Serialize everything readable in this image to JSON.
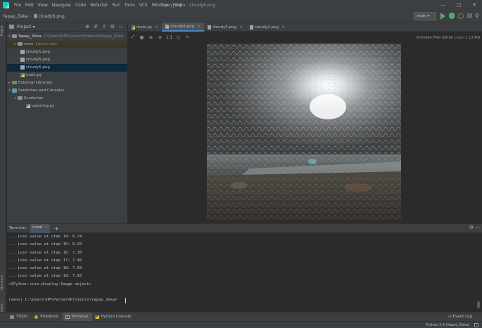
{
  "menubar": {
    "items": [
      "File",
      "Edit",
      "View",
      "Navigate",
      "Code",
      "Refactor",
      "Run",
      "Tools",
      "VCS",
      "Window",
      "Help"
    ],
    "window_title": "Yapay_Zeka - cloudy6.png"
  },
  "navbar": {
    "project": "Yapay_Zeka",
    "file": "cloudy6.png",
    "run_config": "main"
  },
  "left_stripe": {
    "top_tab": "Project",
    "bottom_tabs": [
      "Structure",
      "Favorites"
    ]
  },
  "project_panel": {
    "title": "Project",
    "root": {
      "name": "Yapay_Zeka",
      "path": "C:\\Users\\HP\\PycharmProjects\\Yapay_Zeka"
    },
    "venv": {
      "name": "venv",
      "hint": "library root"
    },
    "files": [
      "cloudy1.png",
      "cloudy5.png",
      "cloudy6.png",
      "main.py"
    ],
    "external_libraries": "External Libraries",
    "scratches_root": "Scratches and Consoles",
    "scratches_folder": "Scratches",
    "scratch_file": "Learning.py"
  },
  "editor": {
    "tabs": [
      "main.py",
      "cloudy6.png",
      "cloudy5.png",
      "cloudy1.png"
    ],
    "active_tab": "cloudy6.png",
    "image_info": "674x664 PNG (24-bit color) 1.13 MB"
  },
  "terminal": {
    "title": "Terminal:",
    "session": "Local",
    "lines": [
      "... Loss value at step 14: 6.74",
      "... Loss value at step 15: 6.94",
      "... Loss value at step 16: 7.30",
      "... Loss value at step 17: 7.46",
      "... Loss value at step 18: 7.83",
      "... Loss value at step 19: 7.93",
      "<IPython.core.display.Image object>"
    ],
    "prompt": "(venv) C:\\Users\\HP\\PycharmProjects\\Yapay_Zeka>"
  },
  "bottom_tabs": {
    "todo": "TODO",
    "problems": "Problems",
    "terminal": "Terminal",
    "python_console": "Python Console",
    "event_log": "Event Log"
  },
  "statusbar": {
    "interpreter": "Python 3.9 (Yapay_Zeka)"
  }
}
